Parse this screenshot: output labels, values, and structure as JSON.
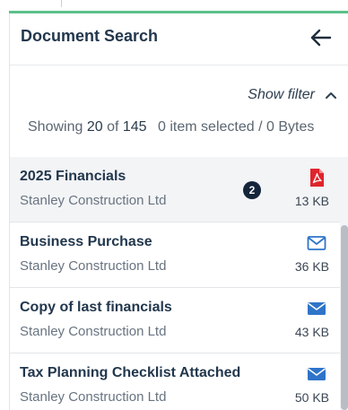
{
  "panel": {
    "title": "Document Search",
    "back_icon": "arrow-left-icon"
  },
  "filter": {
    "label": "Show filter",
    "toggle_icon": "chevron-up-icon"
  },
  "summary": {
    "prefix": "Showing",
    "shown": "20",
    "of_word": "of",
    "total": "145",
    "selection": "0 item selected / 0 Bytes"
  },
  "items": [
    {
      "title": "2025 Financials",
      "company": "Stanley Construction Ltd",
      "size": "13 KB",
      "icon": "pdf-file-icon",
      "selected": true,
      "badge": "2"
    },
    {
      "title": "Business Purchase",
      "company": "Stanley Construction Ltd",
      "size": "36 KB",
      "icon": "email-outline-icon"
    },
    {
      "title": "Copy of last financials",
      "company": "Stanley Construction Ltd",
      "size": "43 KB",
      "icon": "email-filled-icon"
    },
    {
      "title": "Tax Planning Checklist Attached",
      "company": "Stanley Construction Ltd",
      "size": "50 KB",
      "icon": "email-filled-icon"
    }
  ],
  "colors": {
    "accent": "#5cc08a",
    "pdf_red": "#e0242b",
    "mail_blue": "#2f74c9",
    "badge_bg": "#14243a"
  }
}
